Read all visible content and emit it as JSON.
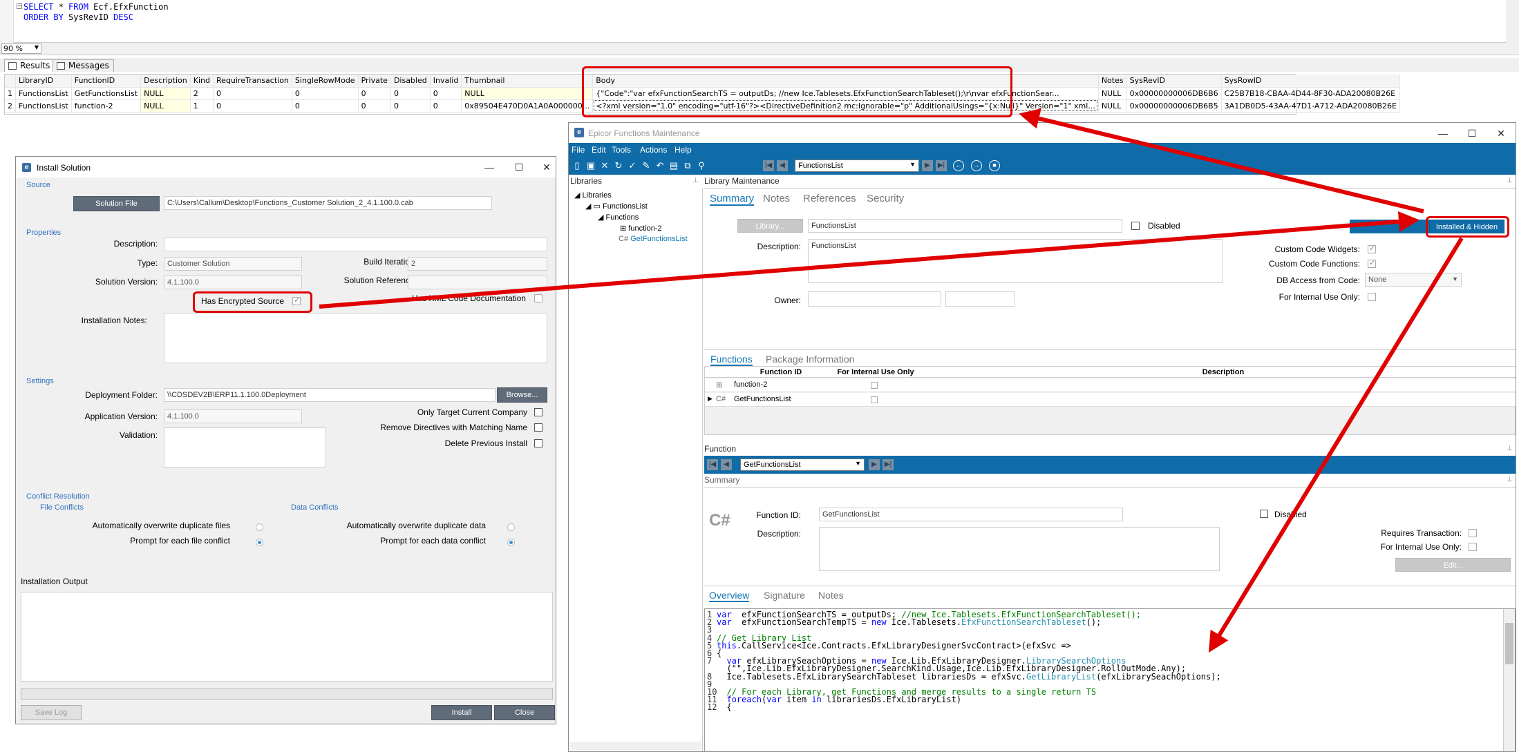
{
  "sql": {
    "line1_kw": "SELECT",
    "line1_rest": " * ",
    "line1_kw2": "FROM",
    "line1_tail": " Ecf.EfxFunction",
    "line2_kw": "ORDER BY",
    "line2_mid": " SysRevID ",
    "line2_kw2": "DESC",
    "zoom": "90 %"
  },
  "result_tabs": {
    "results": "Results",
    "messages": "Messages"
  },
  "grid": {
    "columns": [
      "LibraryID",
      "FunctionID",
      "Description",
      "Kind",
      "RequireTransaction",
      "SingleRowMode",
      "Private",
      "Disabled",
      "Invalid",
      "Thumbnail",
      "Body",
      "Notes",
      "SysRevID",
      "SysRowID"
    ],
    "rows": [
      [
        "1",
        "FunctionsList",
        "GetFunctionsList",
        "NULL",
        "2",
        "0",
        "0",
        "0",
        "0",
        "0",
        "NULL",
        "{\"Code\":\"var  efxFunctionSearchTS = outputDs; //new Ice.Tablesets.EfxFunctionSearchTableset();\\r\\nvar  efxFunctionSear...",
        "NULL",
        "0x00000000006DB6B6",
        "C25B7B18-CBAA-4D44-8F30-ADA20080B26E"
      ],
      [
        "2",
        "FunctionsList",
        "function-2",
        "NULL",
        "1",
        "0",
        "0",
        "0",
        "0",
        "0",
        "0x89504E470D0A1A0A000000...",
        "<?xml version=\"1.0\" encoding=\"utf-16\"?><DirectiveDefinition2 mc:Ignorable=\"p\" AdditionalUsings=\"{x:Null}\" Version=\"1\" xml...",
        "NULL",
        "0x00000000006DB6B5",
        "3A1DB0D5-43AA-47D1-A712-ADA20080B26E"
      ]
    ]
  },
  "install": {
    "title": "Install Solution",
    "source_section": "Source",
    "solution_file_btn": "Solution File",
    "solution_file_path": "C:\\Users\\Callum\\Desktop\\Functions_Customer Solution_2_4.1.100.0.cab",
    "properties_section": "Properties",
    "description_label": "Description:",
    "type_label": "Type:",
    "type_value": "Customer Solution",
    "build_iteration_label": "Build Iteration:",
    "build_iteration_value": "2",
    "solution_version_label": "Solution Version:",
    "solution_version_value": "4.1.100.0",
    "solution_reference_label": "Solution Reference:",
    "has_encrypted_source": "Has Encrypted Source",
    "has_xml_doc": "Has XML Code Documentation",
    "installation_notes_label": "Installation Notes:",
    "settings_section": "Settings",
    "deployment_folder_label": "Deployment Folder:",
    "deployment_folder_value": "\\\\CDSDEV2B\\ERP11.1.100.0Deployment",
    "browse_btn": "Browse...",
    "application_version_label": "Application Version:",
    "application_version_value": "4.1.100.0",
    "only_target_label": "Only Target Current Company",
    "remove_directives_label": "Remove Directives with Matching Name",
    "delete_previous_label": "Delete Previous Install",
    "validation_label": "Validation:",
    "conflict_section": "Conflict Resolution",
    "file_conflicts": "File Conflicts",
    "data_conflicts": "Data Conflicts",
    "auto_overwrite_files": "Automatically overwrite duplicate files",
    "prompt_file": "Prompt for each file conflict",
    "auto_overwrite_data": "Automatically overwrite duplicate data",
    "prompt_data": "Prompt for each data conflict",
    "installation_output": "Installation Output",
    "save_log_btn": "Save Log",
    "install_btn": "Install",
    "close_btn": "Close"
  },
  "epicor": {
    "title": "Epicor Functions Maintenance",
    "menu": [
      "File",
      "Edit",
      "Tools",
      "Actions",
      "Help"
    ],
    "library_select": "FunctionsList",
    "libraries_panel": "Libraries",
    "tree": {
      "root": "Libraries",
      "library": "FunctionsList",
      "functions": "Functions",
      "fn1": "function-2",
      "fn2": "GetFunctionsList"
    },
    "library_maintenance": "Library Maintenance",
    "tabs": [
      "Summary",
      "Notes",
      "References",
      "Security"
    ],
    "library_btn": "Library...",
    "library_value": "FunctionsList",
    "disabled_label": "Disabled",
    "description_label": "Description:",
    "description_value": "FunctionsList",
    "installed_hidden_btn": "Installed & Hidden",
    "owner_label": "Owner:",
    "custom_code_widgets": "Custom Code Widgets:",
    "custom_code_functions": "Custom Code Functions:",
    "db_access_label": "DB Access from Code:",
    "db_access_value": "None",
    "for_internal_use_label": "For Internal Use Only:",
    "lower_tabs": [
      "Functions",
      "Package Information"
    ],
    "fn_grid_headers": [
      "Function ID",
      "For Internal Use Only",
      "Description"
    ],
    "fn_grid_rows": [
      "function-2",
      "GetFunctionsList"
    ],
    "function_section": "Function",
    "function_select": "GetFunctionsList",
    "summary_header": "Summary",
    "function_id_label": "Function ID:",
    "function_id_value": "GetFunctionsList",
    "fn_disabled_label": "Disabled",
    "fn_description_label": "Description:",
    "requires_transaction": "Requires Transaction:",
    "fn_internal_use": "For Internal Use Only:",
    "edit_btn": "Edit...",
    "overview_tabs": [
      "Overview",
      "Signature",
      "Notes"
    ]
  },
  "code_lines": [
    {
      "n": "1",
      "parts": [
        [
          "k",
          "var"
        ],
        [
          "",
          "  efxFunctionSearchTS = outputDs; "
        ],
        [
          "c",
          "//new Ice.Tablesets.EfxFunctionSearchTableset();"
        ]
      ]
    },
    {
      "n": "2",
      "parts": [
        [
          "k",
          "var"
        ],
        [
          "",
          "  efxFunctionSearchTempTS = "
        ],
        [
          "k",
          "new"
        ],
        [
          "",
          " Ice.Tablesets."
        ],
        [
          "t",
          "EfxFunctionSearchTableset"
        ],
        [
          "",
          "();"
        ]
      ]
    },
    {
      "n": "3",
      "parts": []
    },
    {
      "n": "4",
      "parts": [
        [
          "c",
          "// Get Library List"
        ]
      ]
    },
    {
      "n": "5",
      "parts": [
        [
          "k",
          "this"
        ],
        [
          "",
          ".CallService<Ice.Contracts.EfxLibraryDesignerSvcContract>(efxSvc =>"
        ]
      ]
    },
    {
      "n": "6",
      "parts": [
        [
          "",
          "{"
        ]
      ]
    },
    {
      "n": "7",
      "parts": [
        [
          "",
          "  "
        ],
        [
          "k",
          "var"
        ],
        [
          "",
          " efxLibrarySeachOptions = "
        ],
        [
          "k",
          "new"
        ],
        [
          "",
          " Ice.Lib.EfxLibraryDesigner."
        ],
        [
          "t",
          "LibrarySearchOptions"
        ]
      ]
    },
    {
      "n": "",
      "parts": [
        [
          "",
          "  (\"\",Ice.Lib.EfxLibraryDesigner.SearchKind.Usage,Ice.Lib.EfxLibraryDesigner.RollOutMode.Any);"
        ]
      ]
    },
    {
      "n": "8",
      "parts": [
        [
          "",
          "  Ice.Tablesets.EfxLibrarySearchTableset librariesDs = efxSvc."
        ],
        [
          "t",
          "GetLibraryList"
        ],
        [
          "",
          "(efxLibrarySeachOptions);"
        ]
      ]
    },
    {
      "n": "9",
      "parts": []
    },
    {
      "n": "10",
      "parts": [
        [
          "",
          "  "
        ],
        [
          "c",
          "// For each Library, get Functions and merge results to a single return TS"
        ]
      ]
    },
    {
      "n": "11",
      "parts": [
        [
          "",
          "  "
        ],
        [
          "k",
          "foreach"
        ],
        [
          "",
          "("
        ],
        [
          "k",
          "var"
        ],
        [
          "",
          " item "
        ],
        [
          "k",
          "in"
        ],
        [
          "",
          " librariesDs.EfxLibraryList)"
        ]
      ]
    },
    {
      "n": "12",
      "parts": [
        [
          "",
          "  {"
        ]
      ]
    }
  ]
}
